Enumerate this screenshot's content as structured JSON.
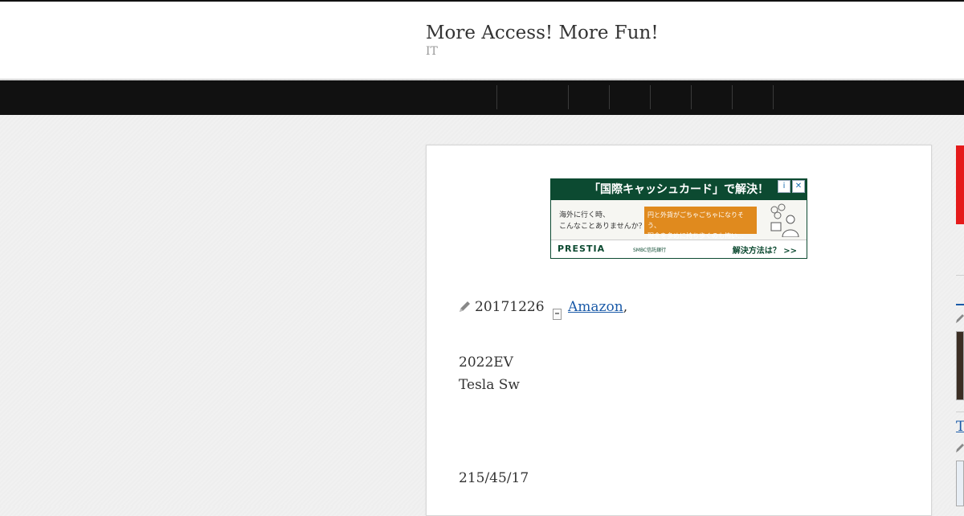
{
  "header": {
    "site_title": "More Access! More Fun!",
    "site_description": "IT"
  },
  "nav": {
    "items": [
      "",
      "",
      "",
      "",
      "",
      "",
      ""
    ]
  },
  "ad": {
    "headline": "「国際キャッシュカード」で解決！",
    "left_text_1": "海外に行く時、",
    "left_text_2": "こんなことありませんか？",
    "orange_text_1": "円と外貨がごちゃごちゃになりそう、",
    "orange_text_2": "現金を多めに持ち歩くのも怖い…",
    "brand": "PRESTIA",
    "brand_sub": "SMBC信託銀行",
    "cta": "解決方法は？ >>",
    "info_icon": "info-icon",
    "close_icon": "close-icon"
  },
  "post": {
    "date": "20171226",
    "category": "Amazon",
    "category_separator": ",",
    "lines": [
      "2022EV",
      "Tesla Sw",
      "215/45/17"
    ]
  },
  "sidebar": {
    "link_letter": "T"
  },
  "colors": {
    "nav_bg": "#111111",
    "ad_green": "#0c4a31",
    "ad_orange": "#e08a1e",
    "link": "#1a5aa8",
    "side_ad": "#e51a1a"
  }
}
